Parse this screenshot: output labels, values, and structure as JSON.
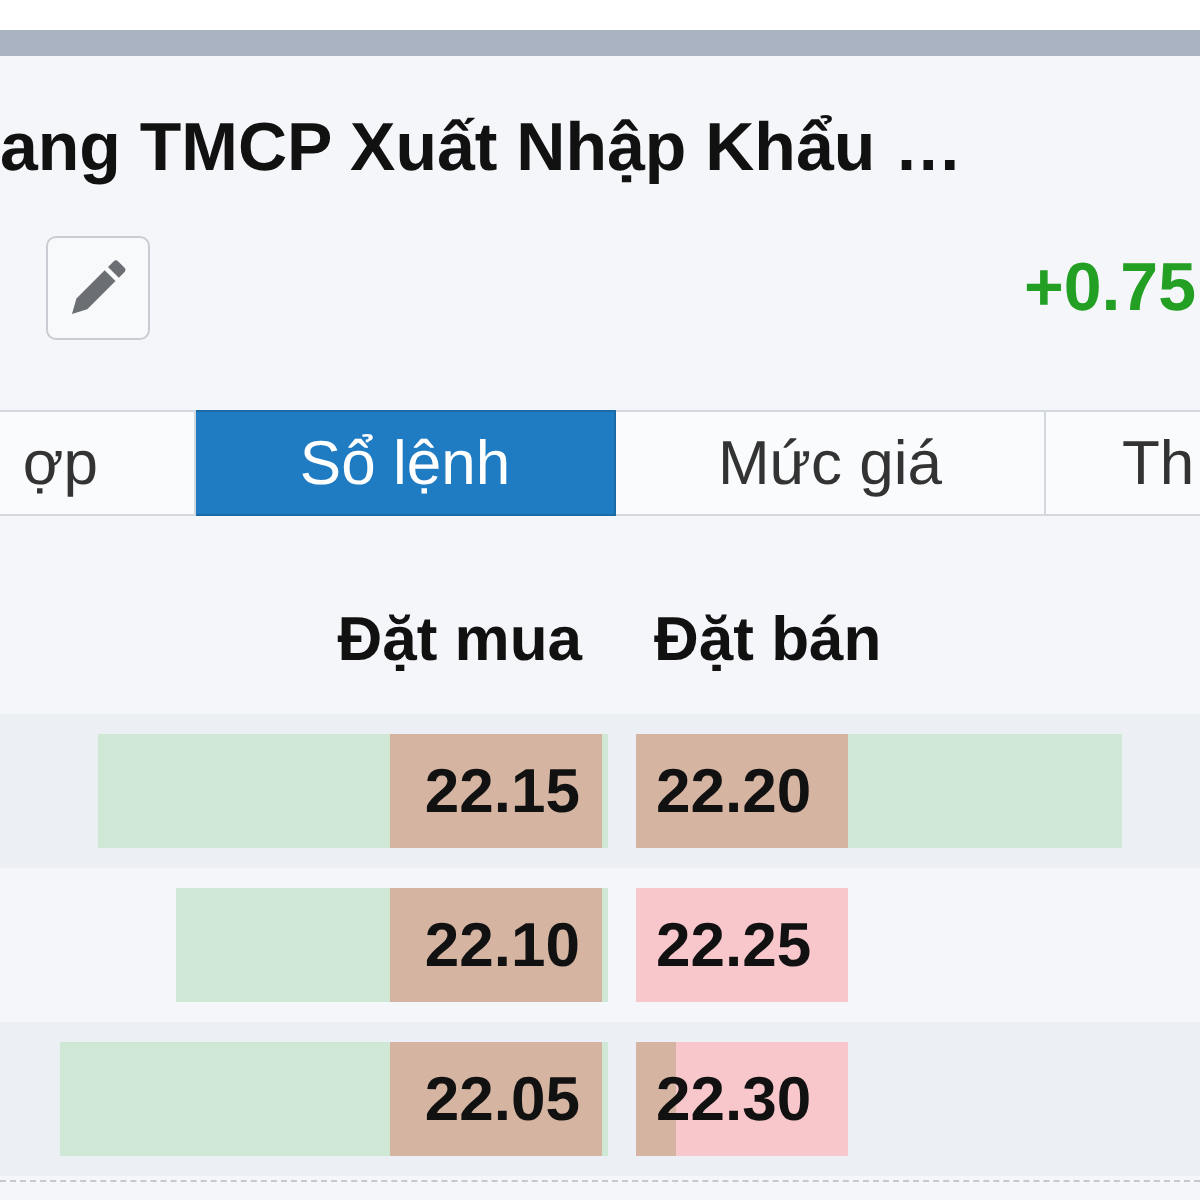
{
  "title": "ang TMCP Xuất Nhập Khẩu …",
  "price_change": "+0.75",
  "tabs": [
    {
      "label": "ợp",
      "selected": false
    },
    {
      "label": "Sổ lệnh",
      "selected": true
    },
    {
      "label": "Mức giá",
      "selected": false
    },
    {
      "label": "Th",
      "selected": false
    }
  ],
  "order_book": {
    "columns": [
      "Đặt mua",
      "Đặt bán"
    ],
    "rows": [
      {
        "bid_price": "22.15",
        "ask_price": "22.20"
      },
      {
        "bid_price": "22.10",
        "ask_price": "22.25"
      },
      {
        "bid_price": "22.05",
        "ask_price": "22.30"
      }
    ]
  }
}
